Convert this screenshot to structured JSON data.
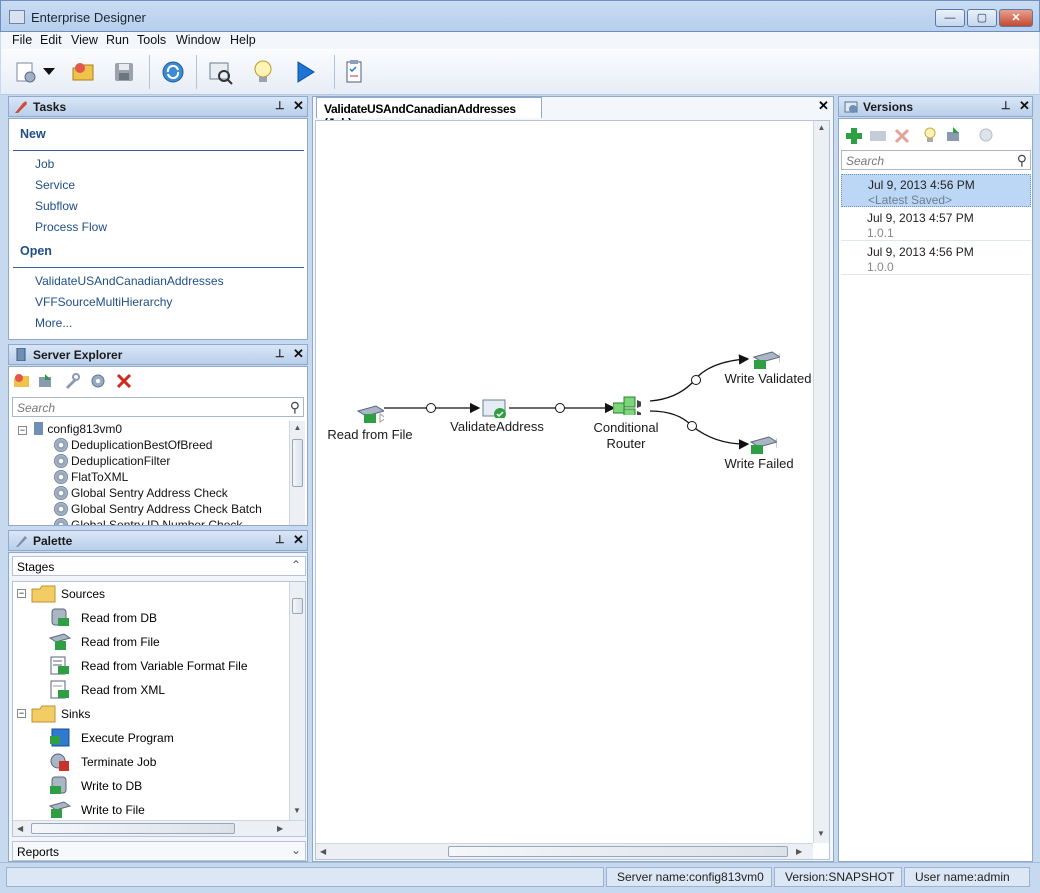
{
  "window": {
    "title": "Enterprise Designer",
    "minimize": "—",
    "maximize": "▢",
    "close": "✕"
  },
  "menu": [
    "File",
    "Edit",
    "View",
    "Run",
    "Tools",
    "Window",
    "Help"
  ],
  "tasks": {
    "header": "Tasks",
    "new_label": "New",
    "new_items": [
      "Job",
      "Service",
      "Subflow",
      "Process Flow"
    ],
    "open_label": "Open",
    "open_items": [
      "ValidateUSAndCanadianAddresses",
      "VFFSourceMultiHierarchy",
      "More..."
    ]
  },
  "server_explorer": {
    "header": "Server Explorer",
    "search_placeholder": "Search",
    "root": "config813vm0",
    "items": [
      "DeduplicationBestOfBreed",
      "DeduplicationFilter",
      "FlatToXML",
      "Global Sentry Address Check",
      "Global Sentry Address Check Batch",
      "Global Sentry ID Number Check"
    ]
  },
  "palette": {
    "header": "Palette",
    "dropdown": "Stages",
    "bottom_dropdown": "Reports",
    "groups": [
      {
        "name": "Sources",
        "items": [
          "Read from DB",
          "Read from File",
          "Read from Variable Format File",
          "Read from XML"
        ]
      },
      {
        "name": "Sinks",
        "items": [
          "Execute Program",
          "Terminate Job",
          "Write to DB",
          "Write to File"
        ]
      }
    ]
  },
  "canvas": {
    "tab_label": "ValidateUSAndCanadianAddresses (Job)",
    "nodes": {
      "read": "Read from File",
      "validate": "ValidateAddress",
      "router_line1": "Conditional",
      "router_line2": "Router",
      "write_valid": "Write Validated",
      "write_failed": "Write Failed"
    }
  },
  "versions": {
    "header": "Versions",
    "search_placeholder": "Search",
    "rows": [
      {
        "date": "Jul 9, 2013 4:56 PM",
        "label": "<Latest Saved>",
        "selected": true
      },
      {
        "date": "Jul 9, 2013 4:57 PM",
        "label": "1.0.1",
        "selected": false
      },
      {
        "date": "Jul 9, 2013 4:56 PM",
        "label": "1.0.0",
        "selected": false
      }
    ]
  },
  "status": {
    "server": "Server name:config813vm0",
    "version": "Version:SNAPSHOT",
    "user": "User name:admin"
  },
  "colors": {
    "accent": "#1f4e87",
    "selection": "#bcd7f5",
    "chrome": "#c7d9ee",
    "flow_arrow": "#1a56d6"
  }
}
